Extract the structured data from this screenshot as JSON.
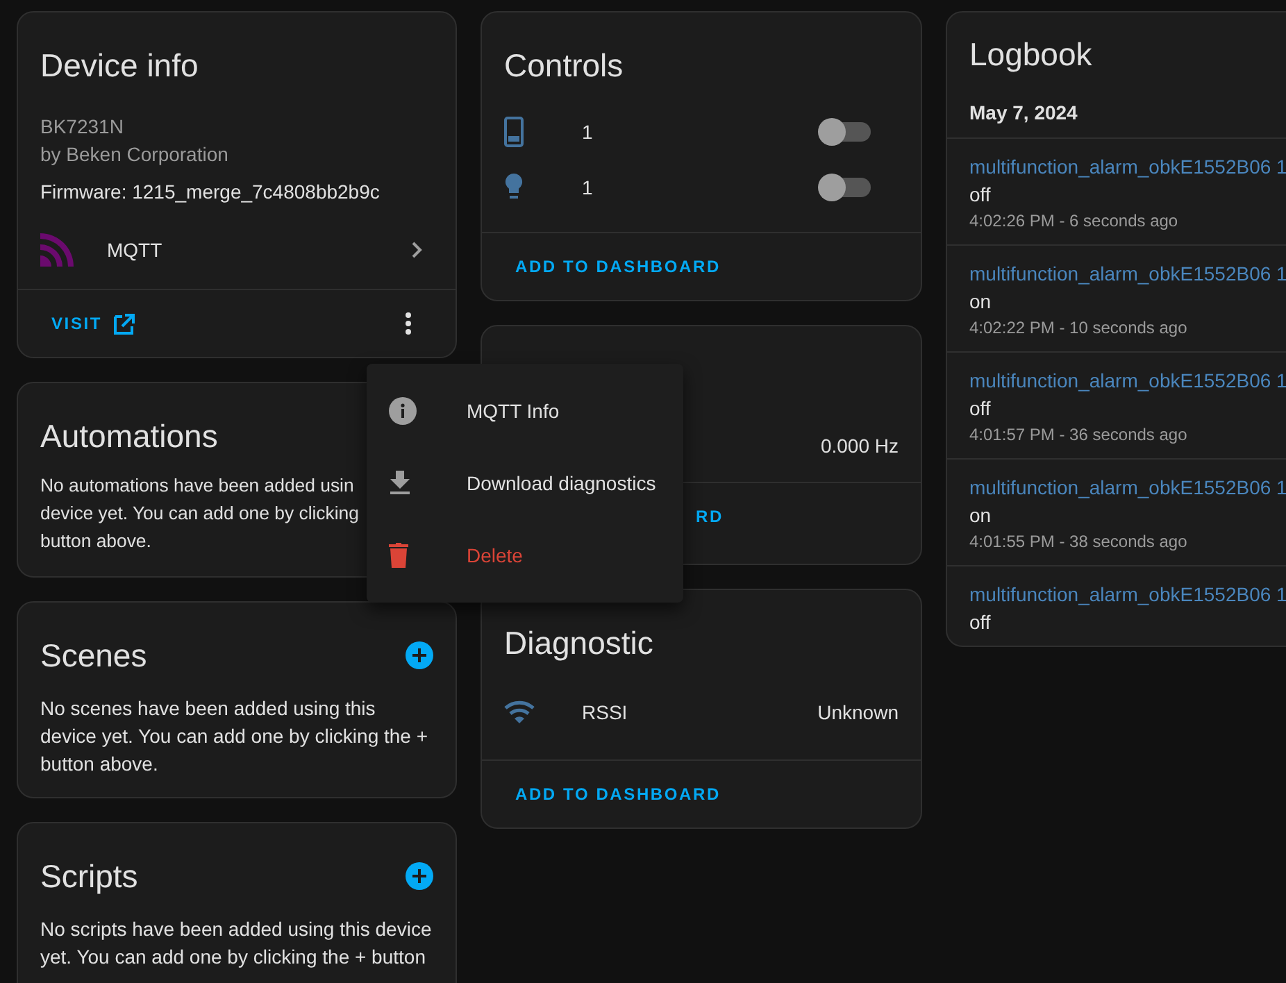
{
  "device_info": {
    "title": "Device info",
    "model": "BK7231N",
    "manufacturer": "by Beken Corporation",
    "firmware": "Firmware: 1215_merge_7c4808bb2b9c",
    "integration": "MQTT",
    "visit": "VISIT"
  },
  "automations": {
    "title": "Automations",
    "lines": [
      "No automations have been added usin",
      "device yet. You can add one by clicking",
      "button above."
    ]
  },
  "scenes": {
    "title": "Scenes",
    "text": "No scenes have been added using this device yet. You can add one by clicking the + button above."
  },
  "scripts": {
    "title": "Scripts",
    "text": "No scripts have been added using this device yet. You can add one by clicking the + button"
  },
  "controls": {
    "title": "Controls",
    "rows": [
      {
        "kind": "phone",
        "label": "1",
        "on": false
      },
      {
        "kind": "bulb",
        "label": "1",
        "on": false
      }
    ],
    "footer": "ADD TO DASHBOARD"
  },
  "sensors": {
    "value": "0.000 Hz",
    "footer": "RD"
  },
  "diagnostic": {
    "title": "Diagnostic",
    "rows": [
      {
        "kind": "wifi",
        "label": "RSSI",
        "value": "Unknown"
      }
    ],
    "footer": "ADD TO DASHBOARD"
  },
  "logbook": {
    "title": "Logbook",
    "date": "May 7, 2024",
    "entries": [
      {
        "entity": "multifunction_alarm_obkE1552B06 1",
        "state": "off",
        "time": "4:02:26 PM - 6 seconds ago"
      },
      {
        "entity": "multifunction_alarm_obkE1552B06 1",
        "state": "on",
        "time": "4:02:22 PM - 10 seconds ago"
      },
      {
        "entity": "multifunction_alarm_obkE1552B06 1",
        "state": "off",
        "time": "4:01:57 PM - 36 seconds ago"
      },
      {
        "entity": "multifunction_alarm_obkE1552B06 1",
        "state": "on",
        "time": "4:01:55 PM - 38 seconds ago"
      },
      {
        "entity": "multifunction_alarm_obkE1552B06 1",
        "state": "off"
      }
    ]
  },
  "menu": {
    "items": [
      {
        "kind": "info",
        "label": "MQTT Info"
      },
      {
        "kind": "download",
        "label": "Download diagnostics"
      },
      {
        "kind": "delete",
        "label": "Delete"
      }
    ]
  }
}
